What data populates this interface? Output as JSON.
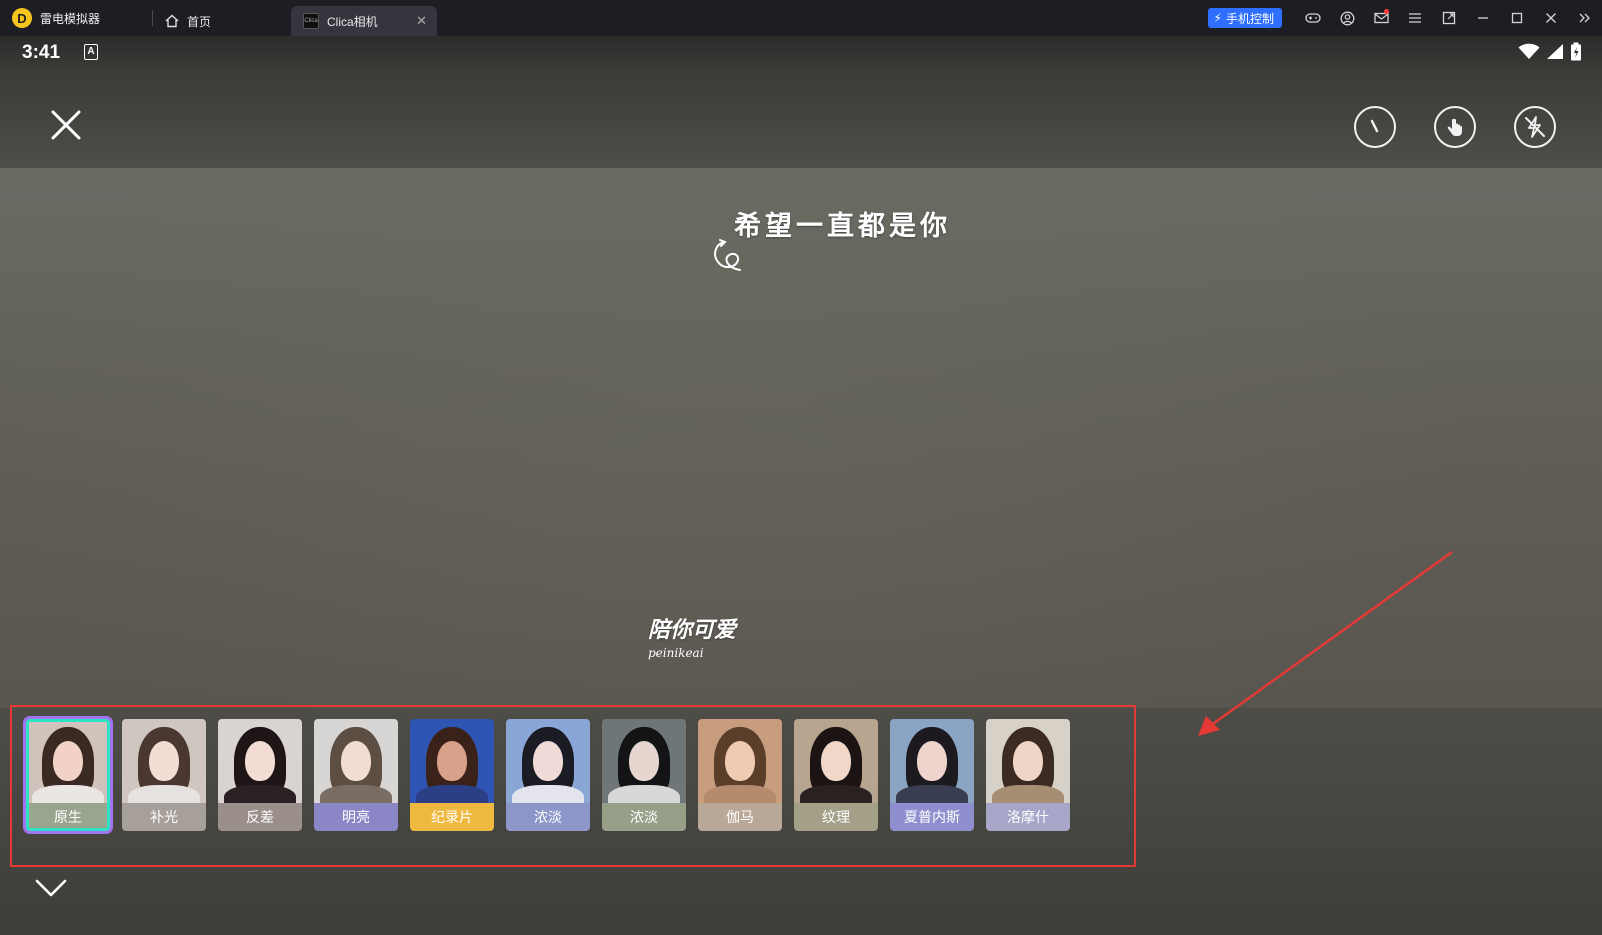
{
  "emulator": {
    "app_name": "雷电模拟器",
    "tabs": [
      {
        "label": "首页"
      },
      {
        "label": "Clica相机"
      }
    ],
    "phone_control_label": "手机控制",
    "window_icons": [
      "gamepad-icon",
      "user-icon",
      "mail-icon",
      "menu-icon",
      "popout-icon",
      "minimize-icon",
      "maximize-icon",
      "close-icon",
      "double-chevron-icon"
    ]
  },
  "status_bar": {
    "time": "3:41",
    "notification_badge": "A"
  },
  "camera": {
    "top_icons": [
      "close-icon",
      "timer-icon",
      "touch-shoot-icon",
      "flash-off-icon"
    ],
    "overlay_title": "希望一直都是你",
    "sticker_main": "陪你可爱",
    "sticker_sub": "peinikeai"
  },
  "filters": [
    {
      "label": "原生",
      "selected": true,
      "label_color": "#9aa58f",
      "bg": "#cfc3bc",
      "hair": "#3b2a24",
      "face": "#f1d2c4",
      "shirt": "#e9e6e4"
    },
    {
      "label": "补光",
      "selected": false,
      "label_color": "#a79f99",
      "bg": "#cfc6c0",
      "hair": "#4a3830",
      "face": "#f2dcd3",
      "shirt": "#e6e2df"
    },
    {
      "label": "反差",
      "selected": false,
      "label_color": "#9a8f8b",
      "bg": "#d9d4d2",
      "hair": "#1e1616",
      "face": "#f3dcd4",
      "shirt": "#2a2222"
    },
    {
      "label": "明亮",
      "selected": false,
      "label_color": "#8b86c6",
      "bg": "#d8d6d4",
      "hair": "#5d4e44",
      "face": "#f2ddd2",
      "shirt": "#7a6e64"
    },
    {
      "label": "纪录片",
      "selected": false,
      "label_color": "#efb83f",
      "bg": "#2f55b4",
      "hair": "#3a221b",
      "face": "#d9a08a",
      "shirt": "#2a3f86"
    },
    {
      "label": "浓淡",
      "selected": false,
      "label_color": "#8d96c9",
      "bg": "#8aa6d6",
      "hair": "#1b1b24",
      "face": "#f0dad8",
      "shirt": "#e3e4ec"
    },
    {
      "label": "浓淡",
      "selected": false,
      "label_color": "#979f88",
      "bg": "#6f7678",
      "hair": "#141416",
      "face": "#e7d6d0",
      "shirt": "#d8d8d6"
    },
    {
      "label": "伽马",
      "selected": false,
      "label_color": "#b9a798",
      "bg": "#c79d7e",
      "hair": "#5b3e2a",
      "face": "#efcbb3",
      "shirt": "#b48b6c"
    },
    {
      "label": "纹理",
      "selected": false,
      "label_color": "#a4a088",
      "bg": "#b7a58f",
      "hair": "#1b1412",
      "face": "#f0d7c8",
      "shirt": "#2a2220"
    },
    {
      "label": "夏普内斯",
      "selected": false,
      "label_color": "#8f8fd0",
      "bg": "#8aa4c3",
      "hair": "#1c1a1e",
      "face": "#eed4cc",
      "shirt": "#3a3e52"
    },
    {
      "label": "洛摩什",
      "selected": false,
      "label_color": "#a8a6c8",
      "bg": "#d7d1c8",
      "hair": "#3b2b22",
      "face": "#eed5c6",
      "shirt": "#a68e74"
    }
  ],
  "colors": {
    "accent_selected": "#a074f5",
    "accent_selected_inner": "#2ee3c2",
    "annotation_red": "#e53935",
    "phone_control_blue": "#2f6fff"
  }
}
